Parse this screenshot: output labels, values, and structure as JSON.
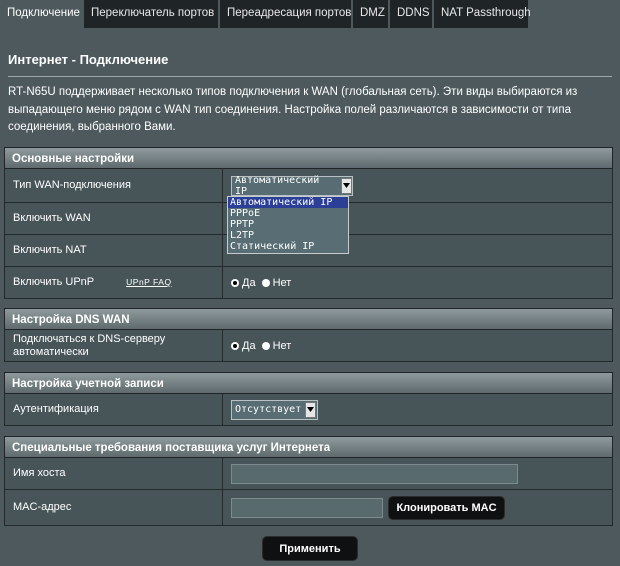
{
  "tabs": [
    "Подключение",
    "Переключатель портов",
    "Переадресация портов",
    "DMZ",
    "DDNS",
    "NAT Passthrough"
  ],
  "page_title": "Интернет - Подключение",
  "description": "RT-N65U поддерживает несколько типов подключения к WAN (глобальная сеть). Эти виды выбираются из выпадающего меню рядом с WAN тип соединения. Настройка полей различаются в зависимости от типа соединения, выбранного Вами.",
  "basic": {
    "header": "Основные настройки",
    "wan_type_label": "Тип WAN-подключения",
    "wan_type_value": "Автоматический IP",
    "wan_type_options": [
      "Автоматический IP",
      "PPPoE",
      "PPTP",
      "L2TP",
      "Статический IP"
    ],
    "enable_wan_label": "Включить WAN",
    "enable_nat_label": "Включить NAT",
    "enable_upnp_label": "Включить UPnP",
    "upnp_faq": "UPnP FAQ",
    "yes": "Да",
    "no": "Нет"
  },
  "dns": {
    "header": "Настройка DNS WAN",
    "auto_label": "Подключаться к DNS-серверу автоматически",
    "yes": "Да",
    "no": "Нет"
  },
  "account": {
    "header": "Настройка учетной записи",
    "auth_label": "Аутентификация",
    "auth_value": "Отсутствует"
  },
  "isp": {
    "header": "Специальные требования поставщика услуг Интернета",
    "host_label": "Имя хоста",
    "host_value": "",
    "mac_label": "MAC-адрес",
    "mac_value": "",
    "clone_mac": "Клонировать MAC"
  },
  "apply": "Применить"
}
